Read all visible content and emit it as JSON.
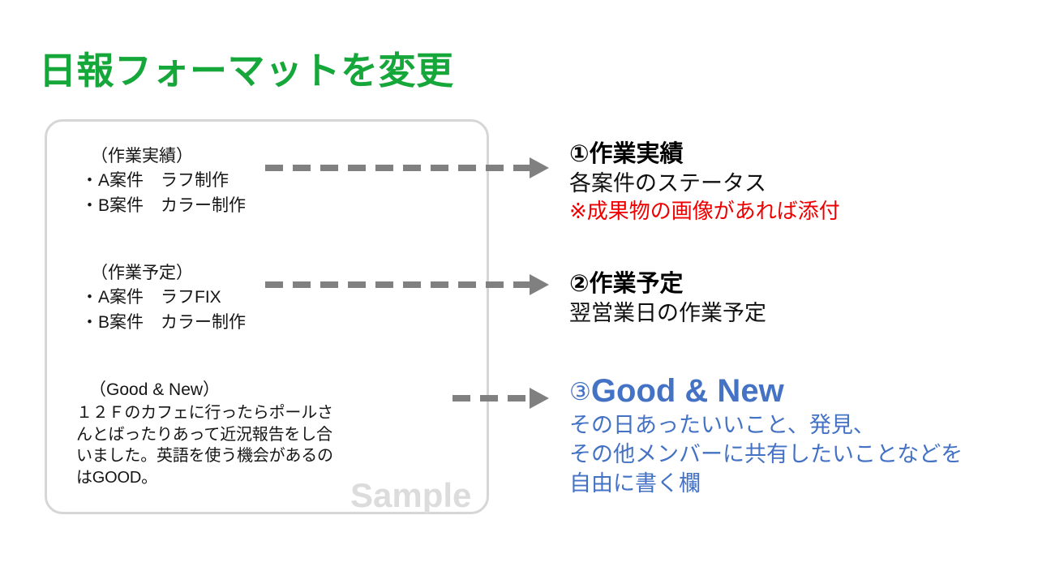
{
  "slide": {
    "title": "日報フォーマットを変更",
    "colors": {
      "title_green": "#16a73a",
      "accent_blue": "#4472c4",
      "note_red": "#ef0000",
      "box_border_gray": "#d6d6d6",
      "arrow_gray": "#808080",
      "watermark_gray": "#dcdcdc"
    }
  },
  "sample_box": {
    "watermark": "Sample",
    "blocks": [
      {
        "heading": "（作業実績）",
        "lines": [
          "・A案件　ラフ制作",
          "・B案件　カラー制作"
        ]
      },
      {
        "heading": "（作業予定）",
        "lines": [
          "・A案件　ラフFIX",
          "・B案件　カラー制作"
        ]
      },
      {
        "heading": "（Good & New）",
        "paragraph": "１２Ｆのカフェに行ったらポールさんとばったりあって近況報告をし合いました。英語を使う機会があるのはGOOD。"
      }
    ]
  },
  "sections": [
    {
      "title": "①作業実績",
      "line": "各案件のステータス",
      "note": "※成果物の画像があれば添付"
    },
    {
      "title": "②作業予定",
      "line": "翌営業日の作業予定"
    },
    {
      "marker": "③",
      "title": "Good & New",
      "line1": "その日あったいいこと、発見、",
      "line2": "その他メンバーに共有したいことなどを",
      "line3": "自由に書く欄"
    }
  ]
}
